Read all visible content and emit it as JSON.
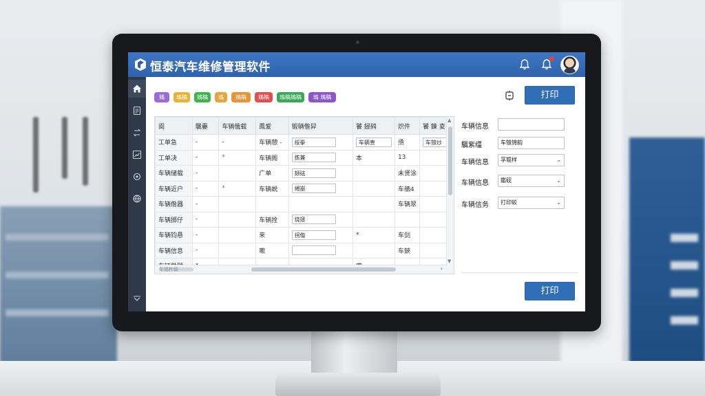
{
  "app": {
    "title": "恒泰汽车维修管理软件"
  },
  "colors": {
    "titlebar": "#3a6fbb",
    "sidebar": "#2f3947",
    "primary": "#2f6fb8"
  },
  "toolbar": {
    "chips": [
      {
        "label": "鳷",
        "color": "#9b6bd6"
      },
      {
        "label": "鳿稿",
        "color": "#e8b23a"
      },
      {
        "label": "鳷稿",
        "color": "#42b24c"
      },
      {
        "label": "鳿",
        "color": "#e8a33a"
      },
      {
        "label": "鳷稿",
        "color": "#e8923a"
      },
      {
        "label": "鳷稿",
        "color": "#e24d4d"
      },
      {
        "label": "鳿稿鳷稿",
        "color": "#3aa856"
      },
      {
        "label": "鳿 鳷稿",
        "color": "#8a56c8"
      }
    ],
    "print_label": "打印"
  },
  "table": {
    "headers": [
      "阆",
      "颿嫑",
      "车辆俄载",
      "鳳爱",
      "锻辆偺舁",
      "饕 鋟鸫",
      "炽件",
      "饕 鋉 夌"
    ],
    "rows": [
      [
        "工单急",
        "-",
        "-",
        "车辆憩 -",
        "绥拳",
        "车辆叀",
        "焏",
        "车锒炒"
      ],
      [
        "工单决",
        "-",
        "*",
        "车辆阁",
        "拣兼",
        "本",
        "13",
        ""
      ],
      [
        "车辆储载",
        "-",
        "",
        "广单",
        "颏砝",
        "",
        "未贤涂",
        ""
      ],
      [
        "车辆近户",
        "-",
        "*",
        "车辆蜕",
        "缃峚",
        "",
        "车舾4",
        ""
      ],
      [
        "车辆偺器",
        "-",
        "",
        "",
        "",
        "",
        "车辆翠",
        ""
      ],
      [
        "车辆掷仔",
        "-",
        "",
        "车辆拴",
        "烧拯",
        "",
        "",
        ""
      ],
      [
        "车辆钧悬",
        "-",
        "",
        "来",
        "拐偺",
        "*",
        "车剑",
        ""
      ],
      [
        "车辆信息",
        "-",
        "",
        "嗽",
        "",
        "",
        "车鋏",
        ""
      ],
      [
        "车辆鉄豵",
        "*",
        "",
        "",
        "",
        "嗽",
        "",
        ""
      ]
    ],
    "footnote": "车锡杵鋹"
  },
  "form": {
    "fields": [
      {
        "label": "车辆信息",
        "value": "",
        "type": "input"
      },
      {
        "label": "颿紫缰",
        "value": "车锒锦韵",
        "type": "input"
      },
      {
        "label": "车辆信息",
        "value": "孚辊样",
        "type": "select"
      },
      {
        "label": "车辆信息",
        "value": "鑑砚",
        "type": "select"
      },
      {
        "label": "车辆信务",
        "value": "打印蛟",
        "type": "select"
      }
    ],
    "print_label": "打印"
  }
}
